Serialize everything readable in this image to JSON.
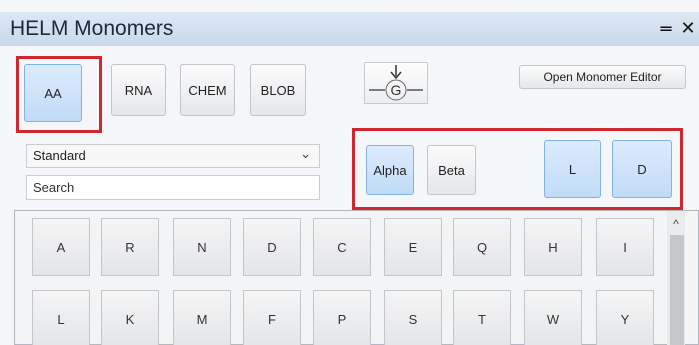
{
  "window": {
    "title": "HELM Monomers",
    "minimize_glyph": "═",
    "close_glyph": "✕"
  },
  "polymer_tabs": [
    {
      "label": "AA",
      "active": true
    },
    {
      "label": "RNA",
      "active": false
    },
    {
      "label": "CHEM",
      "active": false
    },
    {
      "label": "BLOB",
      "active": false
    }
  ],
  "toolbar": {
    "g_icon_label": "G",
    "open_editor_label": "Open Monomer Editor"
  },
  "filters": {
    "set_select_value": "Standard",
    "search_placeholder": "Search"
  },
  "chirality": {
    "alpha_label": "Alpha",
    "beta_label": "Beta",
    "l_label": "L",
    "d_label": "D"
  },
  "monomer_grid": {
    "row1": [
      "A",
      "R",
      "N",
      "D",
      "C",
      "E",
      "Q",
      "H",
      "I"
    ],
    "row2": [
      "L",
      "K",
      "M",
      "F",
      "P",
      "S",
      "T",
      "W",
      "Y"
    ]
  },
  "colors": {
    "highlight": "#d0262d",
    "active_button": "#c1dbf7",
    "titlebar": "#c9d9ea"
  }
}
